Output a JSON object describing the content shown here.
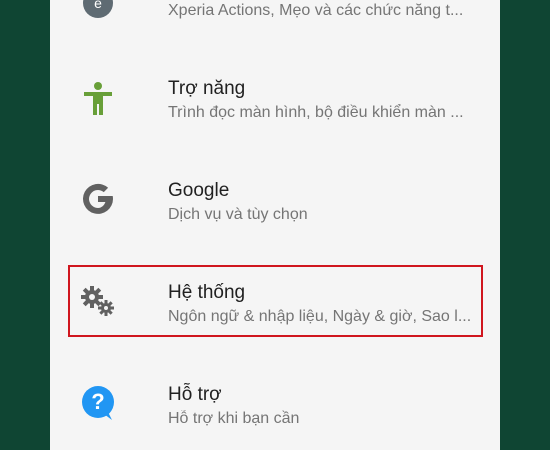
{
  "settings": {
    "items": [
      {
        "title": "",
        "subtitle": "Xperia Actions, Mẹo và các chức năng t...",
        "icon": "xperia-icon"
      },
      {
        "title": "Trợ năng",
        "subtitle": "Trình đọc màn hình, bộ điều khiển màn ...",
        "icon": "accessibility-icon"
      },
      {
        "title": "Google",
        "subtitle": "Dịch vụ và tùy chọn",
        "icon": "google-icon"
      },
      {
        "title": "Hệ thống",
        "subtitle": "Ngôn ngữ & nhập liệu, Ngày & giờ, Sao l...",
        "icon": "gear-icon"
      },
      {
        "title": "Hỗ trợ",
        "subtitle": "Hỗ trợ khi bạn cần",
        "icon": "help-icon"
      }
    ]
  },
  "colors": {
    "background": "#0f4533",
    "panel": "#f5f5f5",
    "highlight": "#d0161e",
    "accessibility_green": "#689f38",
    "help_blue": "#2196f3",
    "icon_gray": "#616161"
  }
}
